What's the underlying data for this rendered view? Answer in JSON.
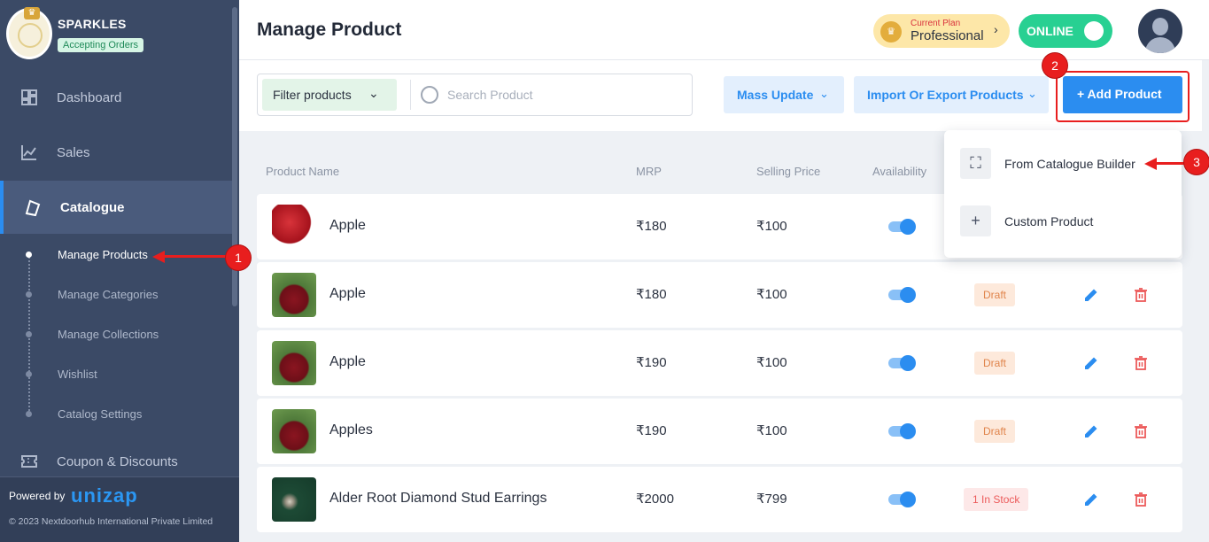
{
  "brand": {
    "name": "SPARKLES",
    "status": "Accepting Orders"
  },
  "sidebar": {
    "items": [
      {
        "label": "Dashboard",
        "icon": "dashboard-icon"
      },
      {
        "label": "Sales",
        "icon": "sales-chart-icon"
      },
      {
        "label": "Catalogue",
        "icon": "catalogue-icon",
        "active": true
      },
      {
        "label": "Coupon & Discounts",
        "icon": "coupon-icon"
      }
    ],
    "sub_items": [
      {
        "label": "Manage Products",
        "active": true
      },
      {
        "label": "Manage Categories"
      },
      {
        "label": "Manage Collections"
      },
      {
        "label": "Wishlist"
      },
      {
        "label": "Catalog Settings"
      }
    ]
  },
  "footer": {
    "powered_by": "Powered by",
    "logo_text": "unizap",
    "copyright": "© 2023 Nextdoorhub International Private Limited"
  },
  "header": {
    "title": "Manage Product",
    "plan_caption": "Current Plan",
    "plan_name": "Professional",
    "online_label": "ONLINE"
  },
  "toolbar": {
    "filter_label": "Filter products",
    "search_placeholder": "Search Product",
    "mass_update": "Mass Update",
    "import_export": "Import Or Export Products",
    "add_product": "+ Add Product"
  },
  "table": {
    "columns": [
      "Product Name",
      "MRP",
      "Selling Price",
      "Availability"
    ],
    "rows": [
      {
        "name": "Apple",
        "mrp": "₹180",
        "selling_price": "₹100",
        "available": true,
        "status": ""
      },
      {
        "name": "Apple",
        "mrp": "₹180",
        "selling_price": "₹100",
        "available": true,
        "status": "Draft"
      },
      {
        "name": "Apple",
        "mrp": "₹190",
        "selling_price": "₹100",
        "available": true,
        "status": "Draft"
      },
      {
        "name": "Apples",
        "mrp": "₹190",
        "selling_price": "₹100",
        "available": true,
        "status": "Draft"
      },
      {
        "name": "Alder Root Diamond Stud Earrings",
        "mrp": "₹2000",
        "selling_price": "₹799",
        "available": true,
        "status": "1 In Stock"
      }
    ]
  },
  "dropdown": {
    "items": [
      {
        "label": "From Catalogue Builder",
        "icon": "catalogue-icon"
      },
      {
        "label": "Custom Product",
        "icon": "plus-icon"
      }
    ]
  },
  "annotations": [
    "1",
    "2",
    "3"
  ],
  "colors": {
    "accent": "#2b8df0",
    "sidebar": "#3b4a66",
    "online": "#28d092",
    "annotation": "#e81e1e"
  }
}
